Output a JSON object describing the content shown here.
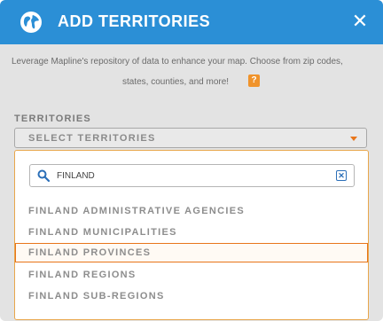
{
  "modal": {
    "title": "ADD TERRITORIES",
    "close_label": "✕",
    "description_line1": "Leverage Mapline's repository of data to enhance your map. Choose from zip codes,",
    "description_line2": "states, counties, and more!",
    "help_label": "?"
  },
  "territories": {
    "label": "TERRITORIES",
    "select_placeholder": "SELECT TERRITORIES",
    "search_value": "FINLAND",
    "clear_label": "✕",
    "options": [
      {
        "label": "FINLAND ADMINISTRATIVE AGENCIES",
        "highlighted": false
      },
      {
        "label": "FINLAND MUNICIPALITIES",
        "highlighted": false
      },
      {
        "label": "FINLAND PROVINCES",
        "highlighted": true
      },
      {
        "label": "FINLAND REGIONS",
        "highlighted": false
      },
      {
        "label": "FINLAND SUB-REGIONS",
        "highlighted": false
      }
    ]
  },
  "colors": {
    "header_blue": "#2b8fd6",
    "accent_orange": "#e8751a"
  },
  "icons": {
    "header": "globe-icon",
    "search": "search-icon",
    "clear": "clear-icon",
    "close": "close-icon",
    "dropdown": "caret-down-icon"
  }
}
